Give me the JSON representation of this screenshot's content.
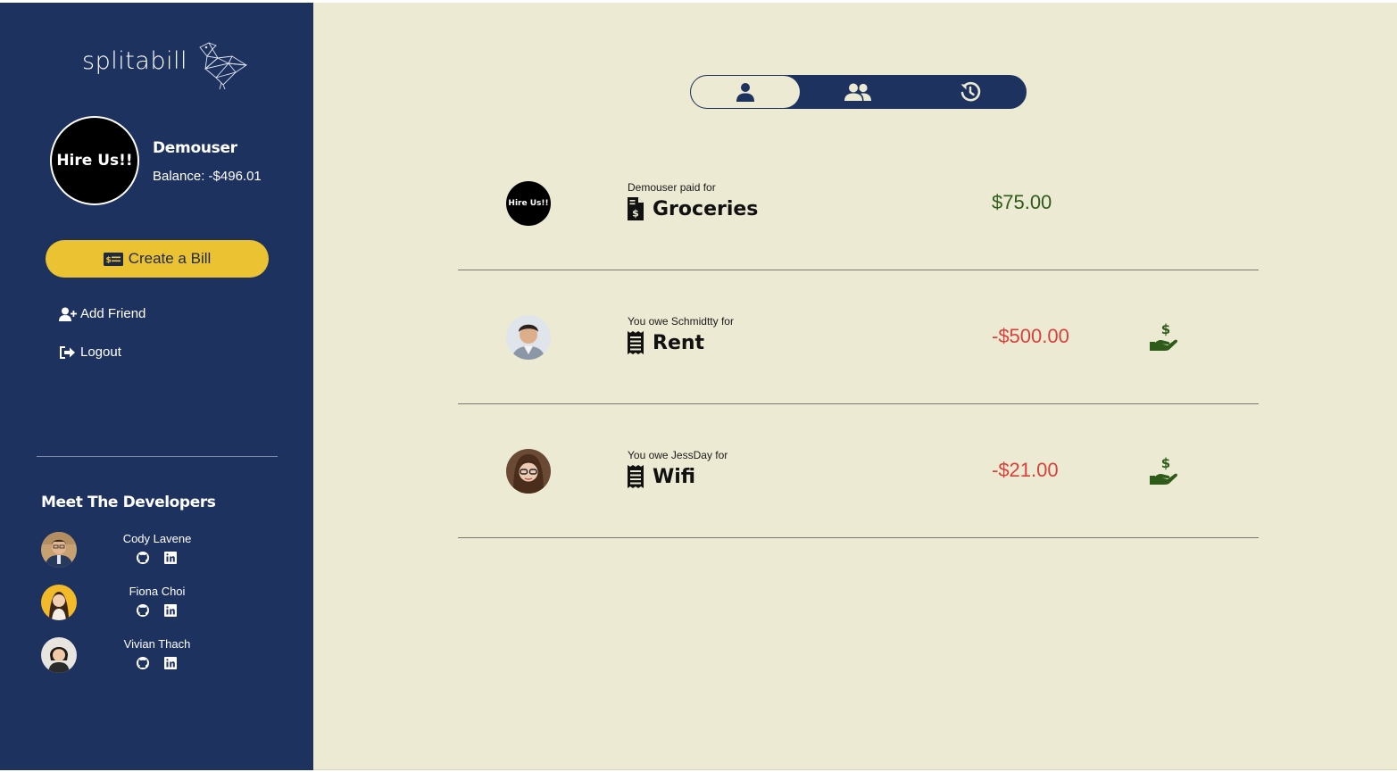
{
  "brand": {
    "name": "splitabill",
    "logo_icon": "geometric-bird-logo"
  },
  "profile": {
    "avatar_text": "Hire Us!!",
    "name": "Demouser",
    "balance_text": "Balance: -$496.01"
  },
  "sidebar": {
    "create_bill_label": "Create a Bill",
    "create_bill_icon": "money-bill-icon",
    "add_friend_label": "Add Friend",
    "logout_label": "Logout",
    "developers_title": "Meet The Developers",
    "developers": [
      {
        "name": "Cody Lavene",
        "links": [
          "github-icon",
          "linkedin-icon"
        ]
      },
      {
        "name": "Fiona Choi",
        "links": [
          "github-icon",
          "linkedin-icon"
        ]
      },
      {
        "name": "Vivian Thach",
        "links": [
          "github-icon",
          "linkedin-icon"
        ]
      }
    ]
  },
  "tabs": [
    {
      "icon": "user-icon",
      "active": true
    },
    {
      "icon": "users-icon",
      "active": false
    },
    {
      "icon": "history-icon",
      "active": false
    }
  ],
  "bills": [
    {
      "avatar_text": "Hire Us!!",
      "caption": "Demouser paid for",
      "title": "Groceries",
      "icon": "file-invoice-dollar-icon",
      "amount": "$75.00",
      "status": "paid"
    },
    {
      "caption": "You owe Schmidtty for",
      "title": "Rent",
      "icon": "receipt-icon",
      "amount": "-$500.00",
      "status": "owed",
      "action_icon": "hand-holding-usd-icon"
    },
    {
      "caption": "You owe JessDay for",
      "title": "Wifi",
      "icon": "receipt-icon",
      "amount": "-$21.00",
      "status": "owed",
      "action_icon": "hand-holding-usd-icon"
    }
  ],
  "colors": {
    "sidebar": "#1e3260",
    "background": "#ecead3",
    "accent": "#ebc232",
    "positive": "#2e5b1a",
    "negative": "#d6423b"
  }
}
